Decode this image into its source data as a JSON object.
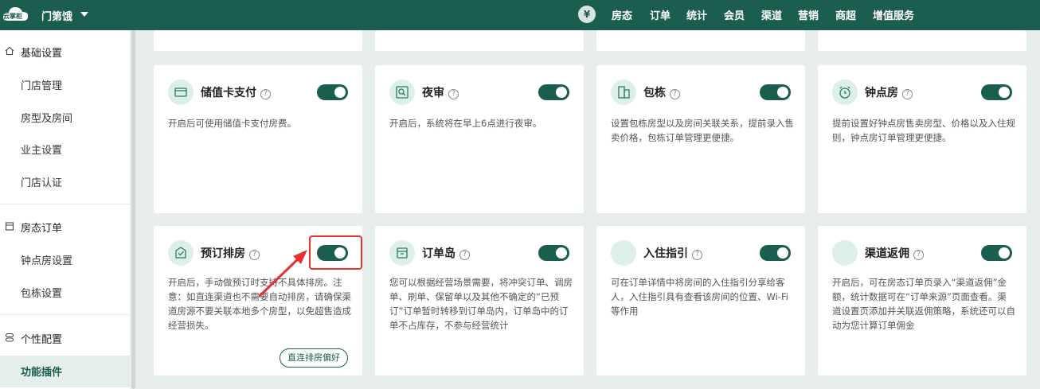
{
  "header": {
    "logo_text": "云掌柜",
    "store_name": "门第饿",
    "currency_icon": "¥",
    "nav": [
      "房态",
      "订单",
      "统计",
      "会员",
      "渠道",
      "营销",
      "商超",
      "增值服务"
    ]
  },
  "sidebar": {
    "sections": [
      {
        "title": "基础设置",
        "items": [
          "门店管理",
          "房型及房间",
          "业主设置",
          "门店认证"
        ]
      },
      {
        "title": "房态订单",
        "items": [
          "钟点房设置",
          "包栋设置"
        ]
      },
      {
        "title": "个性配置",
        "items": [
          "功能插件"
        ]
      }
    ]
  },
  "cards": [
    {
      "title": "储值卡支付",
      "desc": "开启后可使用储值卡支付房费。",
      "enabled": true
    },
    {
      "title": "夜审",
      "desc": "开启后，系统将在早上6点进行夜审。",
      "enabled": true
    },
    {
      "title": "包栋",
      "desc": "设置包栋房型以及房间关联关系，提前录入售卖价格，包栋订单管理更便捷。",
      "enabled": true
    },
    {
      "title": "钟点房",
      "desc": "提前设置好钟点房售卖房型、价格以及入住规则，钟点房订单管理更便捷。",
      "enabled": true
    },
    {
      "title": "预订排房",
      "desc": "开启后，手动做预订时支持不具体排房。注意：如直连渠道也不需要自动排房，请确保渠道房源不要关联本地多个房型，以免超售造成经营损失。",
      "enabled": true,
      "button": "直连排房偏好"
    },
    {
      "title": "订单岛",
      "desc": "您可以根据经营场景需要，将冲突订单、调房单、刷单、保留单以及其他不确定的“已预订”订单暂时转移到订单岛内，订单岛中的订单不占库存，不参与经营统计",
      "enabled": true
    },
    {
      "title": "入住指引",
      "desc": "可在订单详情中将房间的入住指引分享给客人，入住指引具有查看该房间的位置、Wi-Fi等作用",
      "enabled": true
    },
    {
      "title": "渠道返佣",
      "desc": "开启后，可在房态订单页录入“渠道返佣”金额，统计数据可在“订单来源”页面查看。渠道设置页添加并关联返佣策略，系统还可以自动为您计算订单佣金",
      "enabled": true
    }
  ],
  "help_glyph": "?",
  "colors": {
    "brand": "#1b5e4f",
    "highlight": "#e8302c"
  }
}
